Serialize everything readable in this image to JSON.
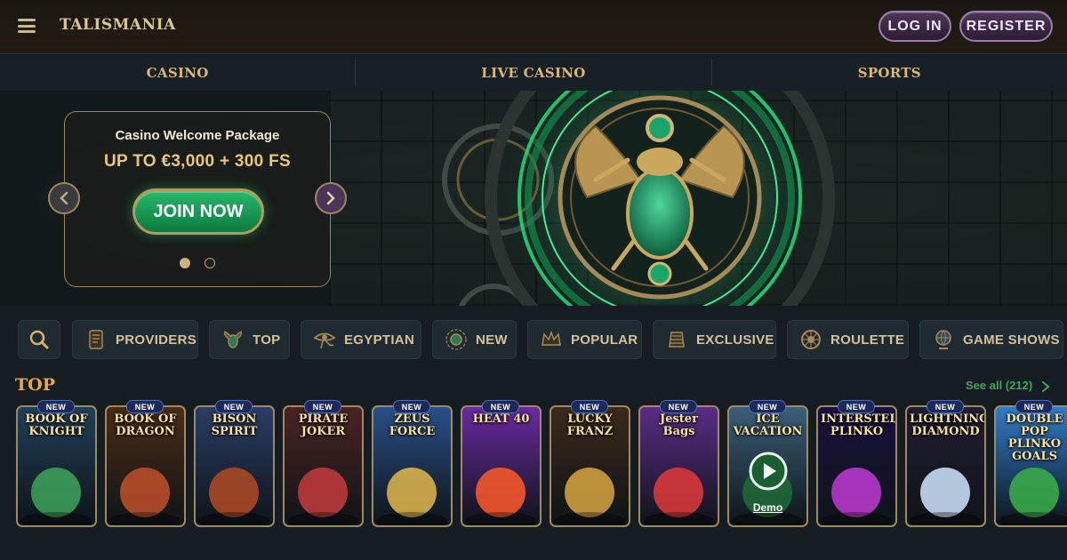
{
  "header": {
    "brand": "TALISMANIA",
    "login_label": "LOG IN",
    "register_label": "REGISTER"
  },
  "nav": {
    "items": [
      {
        "label": "CASINO"
      },
      {
        "label": "LIVE CASINO"
      },
      {
        "label": "SPORTS"
      }
    ]
  },
  "hero": {
    "promo_title": "Casino Welcome Package",
    "promo_offer": "UP TO €3,000 + 300 FS",
    "cta_label": "JOIN NOW",
    "slides": 2,
    "active_slide": 1
  },
  "categories": [
    {
      "label": "PROVIDERS",
      "icon": "scroll-icon"
    },
    {
      "label": "TOP",
      "icon": "scarab-icon"
    },
    {
      "label": "EGYPTIAN",
      "icon": "eye-of-horus-icon"
    },
    {
      "label": "NEW",
      "icon": "sun-disc-icon"
    },
    {
      "label": "POPULAR",
      "icon": "crown-icon"
    },
    {
      "label": "EXCLUSIVE",
      "icon": "pharaoh-icon"
    },
    {
      "label": "ROULETTE",
      "icon": "roulette-icon"
    },
    {
      "label": "GAME SHOWS",
      "icon": "globe-icon"
    }
  ],
  "top_section": {
    "title": "TOP",
    "see_all": "See all (212)",
    "new_badge": "NEW",
    "demo_label": "Demo",
    "games": [
      {
        "title": "BOOK OF KNIGHT",
        "bg": "#1f3f59",
        "accent": "#3da35a"
      },
      {
        "title": "BOOK OF DRAGON",
        "bg": "#4a2c16",
        "accent": "#c0502a"
      },
      {
        "title": "BISON SPIRIT",
        "bg": "#2b3c66",
        "accent": "#b14a24"
      },
      {
        "title": "PIRATE JOKER",
        "bg": "#4b2322",
        "accent": "#c43c3c"
      },
      {
        "title": "ZEUS FORCE",
        "bg": "#2a4f86",
        "accent": "#e0b74b"
      },
      {
        "title": "HEAT 40",
        "bg": "#6a2aa0",
        "accent": "#ff5a2a"
      },
      {
        "title": "LUCKY FRANZ",
        "bg": "#3a2a1a",
        "accent": "#d9a441"
      },
      {
        "title": "Jester Bags",
        "bg": "#5a2c86",
        "accent": "#e23a3a"
      },
      {
        "title": "ICE VACATION",
        "bg": "#3a5f78",
        "accent": "#1e6b38"
      },
      {
        "title": "INTERSTELLAR PLINKO",
        "bg": "#1a1240",
        "accent": "#c13bd6"
      },
      {
        "title": "LIGHTNING DIAMOND",
        "bg": "#221d32",
        "accent": "#cfe6ff"
      },
      {
        "title": "DOUBLE POP PLINKO GOALS",
        "bg": "#2f7cc9",
        "accent": "#3bb04a"
      }
    ]
  },
  "colors": {
    "background": "#151d22",
    "gold_text": "#d7b77a",
    "accent_green": "#27b86b",
    "section_title": "#e6a945",
    "see_all": "#3ca85a"
  }
}
